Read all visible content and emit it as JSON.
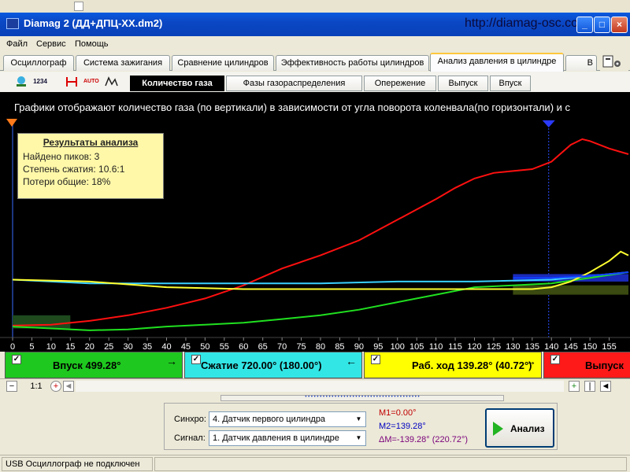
{
  "window": {
    "title": "Diamag 2 (ДД+ДПЦ-XX.dm2)",
    "url_label": "http://diamag-osc.com",
    "minimize_glyph": "_",
    "maximize_glyph": "□",
    "close_glyph": "×"
  },
  "menu": [
    "Файл",
    "Сервис",
    "Помощь"
  ],
  "main_tabs": [
    {
      "label": "Осциллограф"
    },
    {
      "label": "Система зажигания"
    },
    {
      "label": "Сравнение цилиндров"
    },
    {
      "label": "Эффективность работы цилиндров"
    },
    {
      "label": "Анализ давления в цилиндре",
      "active": true
    },
    {
      "label": "В"
    }
  ],
  "toolbar_icons": [
    "wave-settings-icon",
    "numbers-1234-icon",
    "marker-brackets-icon",
    "auto-markers-icon",
    "peak-markers-icon"
  ],
  "toolbar_icon_texts": {
    "numbers": "1234",
    "auto": "AUTO"
  },
  "sub_tabs": [
    {
      "label": "Количество газа",
      "active": true
    },
    {
      "label": "Фазы газораспределения"
    },
    {
      "label": "Опережение"
    },
    {
      "label": "Выпуск"
    },
    {
      "label": "Впуск"
    }
  ],
  "chart_description": "Графики отображают количество газа (по вертикали) в зависимости от угла поворота коленвала(по горизонтали) и с",
  "results": {
    "title": "Результаты анализа",
    "peaks": "Найдено пиков: 3",
    "compression": "Степень сжатия: 10.6:1",
    "losses": "Потери общие: 18%"
  },
  "chart_data": {
    "type": "line",
    "x_axis": {
      "min": 0,
      "max": 160,
      "ticks": [
        0,
        5,
        10,
        15,
        20,
        25,
        30,
        35,
        40,
        45,
        50,
        55,
        60,
        65,
        70,
        75,
        80,
        85,
        90,
        95,
        100,
        105,
        110,
        115,
        120,
        125,
        130,
        135,
        140,
        145,
        150,
        155
      ]
    },
    "grid": false,
    "markers": {
      "left_cursor": 0,
      "right_cursor": 139.28
    },
    "series": [
      {
        "color": "#ff1010",
        "x": [
          0,
          10,
          20,
          30,
          40,
          50,
          60,
          70,
          80,
          90,
          100,
          110,
          115,
          120,
          125,
          130,
          135,
          140,
          145,
          148,
          150,
          155,
          160
        ],
        "y": [
          0.5,
          1,
          3,
          6,
          10,
          15,
          22,
          31,
          38,
          46,
          57,
          68,
          74,
          79,
          82,
          83,
          84,
          88,
          97,
          100,
          99,
          95,
          92
        ]
      },
      {
        "color": "#20e020",
        "x": [
          0,
          10,
          20,
          30,
          40,
          50,
          60,
          70,
          80,
          90,
          100,
          110,
          120,
          130,
          140,
          150,
          160
        ],
        "y": [
          0,
          -1,
          -2,
          -1.5,
          0,
          1,
          2,
          4,
          6,
          9,
          13,
          17,
          21,
          22,
          23,
          26,
          29
        ]
      },
      {
        "color": "#3ad0ff",
        "x": [
          0,
          20,
          40,
          60,
          80,
          100,
          120,
          140,
          150,
          155,
          160
        ],
        "y": [
          25,
          23,
          23,
          23,
          23,
          24,
          24,
          25,
          27,
          28,
          29
        ]
      },
      {
        "color": "#ffff30",
        "x": [
          0,
          20,
          40,
          60,
          80,
          100,
          120,
          135,
          140,
          145,
          150,
          155,
          158,
          160
        ],
        "y": [
          25,
          24,
          21,
          20,
          20,
          20,
          20,
          20,
          21,
          24,
          29,
          35,
          40,
          38
        ]
      },
      {
        "color": "#1040ff",
        "x": [
          130,
          140,
          150,
          155,
          160
        ],
        "y": [
          26,
          26,
          27,
          28,
          29
        ]
      }
    ]
  },
  "bands": [
    {
      "label": "Впуск 499.28°",
      "color": "#1ec81e",
      "text_color": "#000",
      "arrow": "→"
    },
    {
      "label": "Сжатие 720.00° (180.00°)",
      "color": "#33e6e6",
      "text_color": "#000",
      "arrow": "←"
    },
    {
      "label": "Раб. ход 139.28° (40.72°)",
      "color": "#ffff00",
      "text_color": "#000",
      "arrow": "→"
    },
    {
      "label": "Выпуск",
      "color": "#ff1a1a",
      "text_color": "#000",
      "arrow": ""
    }
  ],
  "check_mark": "✓",
  "zoom": {
    "minus": "−",
    "label": "1:1",
    "plus": "+"
  },
  "scroll_glyphs": {
    "left": "◄",
    "first": "|◄",
    "prev": "◄"
  },
  "splitter_glyph": "• • • • • • • • • • • • • • • • • • • • • • • • • • • • • • • • • • • • • • •",
  "sync": {
    "label": "Синхро:",
    "value": "4. Датчик первого цилиндра"
  },
  "signal": {
    "label": "Сигнал:",
    "value": "1. Датчик давления в цилиндре"
  },
  "dropdown_glyph": "▼",
  "measurements": {
    "m1": "M1=0.00°",
    "m2": "M2=139.28°",
    "dm": "ΔM=-139.28° (220.72°)"
  },
  "colors": {
    "m1": "#c00000",
    "m2": "#0000c0",
    "dm": "#7a007a"
  },
  "analyze_button": "Анализ",
  "status": {
    "usb": "USB Осциллограф не подключен"
  }
}
